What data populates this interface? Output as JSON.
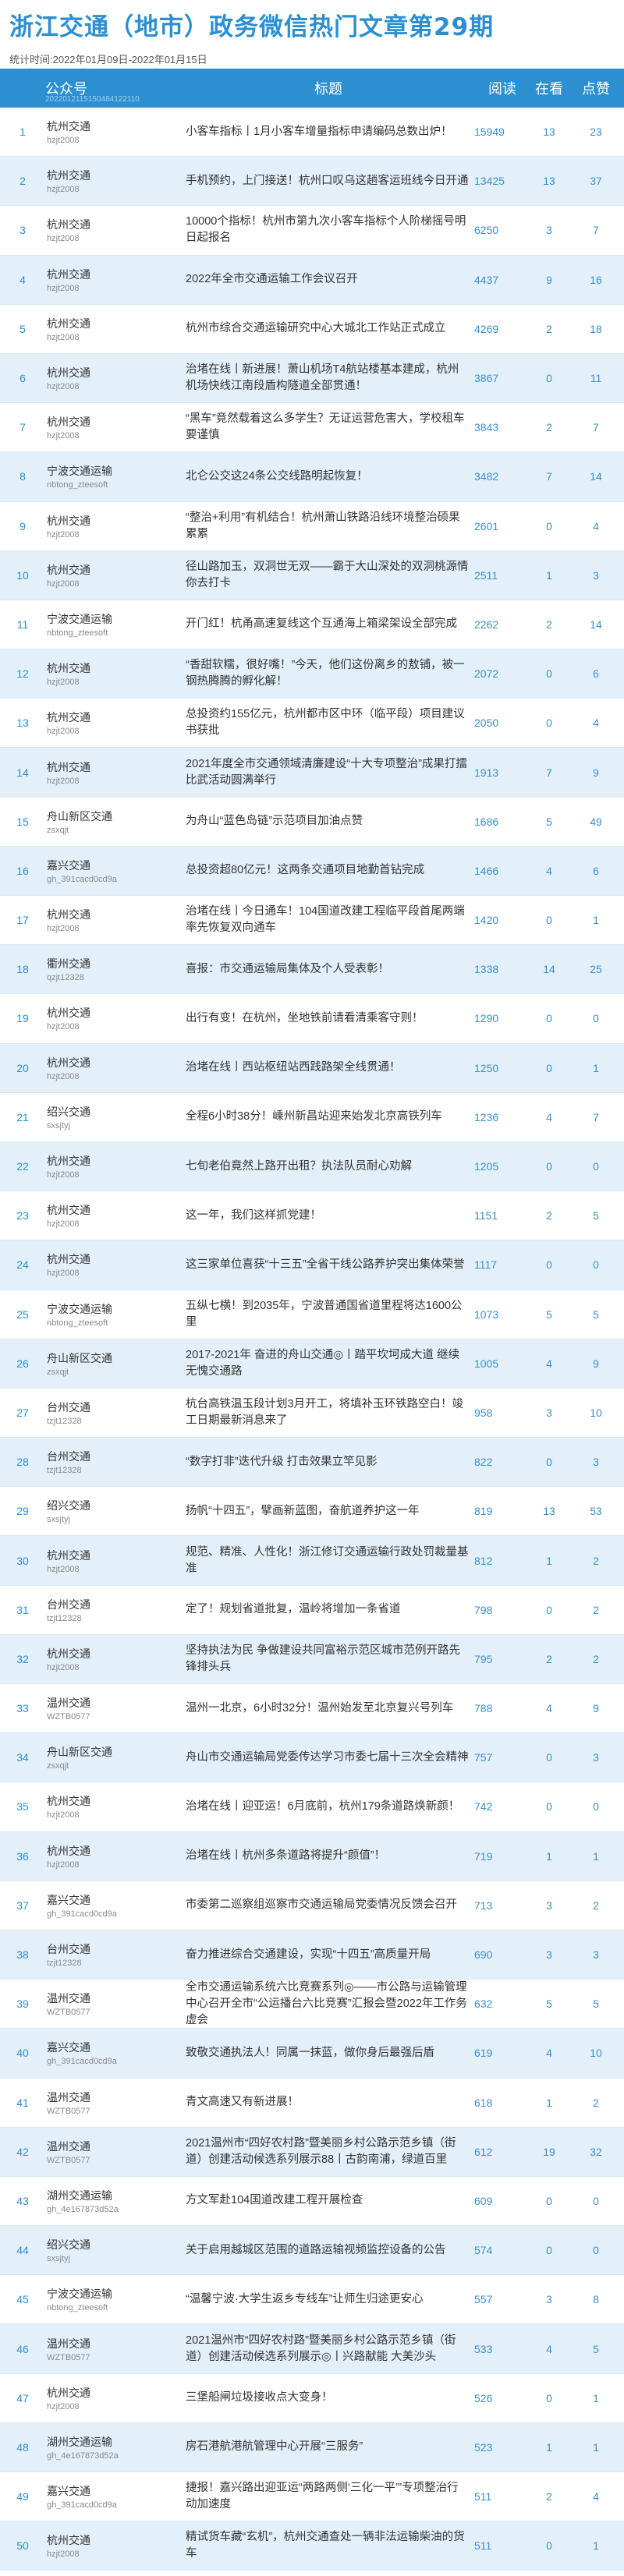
{
  "title": "浙江交通（地市）政务微信热门文章第29期",
  "stat_period": "统计时间:2022年01月09日-2022年01月15日",
  "header": {
    "col_name": "公众号",
    "col_title": "标题",
    "col_read": "阅读",
    "col_look": "在看",
    "col_like": "点赞",
    "sub": "2022012115150484122110"
  },
  "rows": [
    {
      "idx": "1",
      "name": "杭州交通",
      "id": "hzjt2008",
      "title": "小客车指标丨1月小客车增量指标申请编码总数出炉！",
      "read": "15949",
      "look": "13",
      "like": "23"
    },
    {
      "idx": "2",
      "name": "杭州交通",
      "id": "hzjt2008",
      "title": "手机预约，上门接送！杭州口叹乌这趟客运班线今日开通",
      "read": "13425",
      "look": "13",
      "like": "37"
    },
    {
      "idx": "3",
      "name": "杭州交通",
      "id": "hzjt2008",
      "title": "10000个指标！杭州市第九次小客车指标个人阶梯摇号明日起报名",
      "read": "6250",
      "look": "3",
      "like": "7"
    },
    {
      "idx": "4",
      "name": "杭州交通",
      "id": "hzjt2008",
      "title": "2022年全市交通运输工作会议召开",
      "read": "4437",
      "look": "9",
      "like": "16"
    },
    {
      "idx": "5",
      "name": "杭州交通",
      "id": "hzjt2008",
      "title": "杭州市综合交通运输研究中心大城北工作站正式成立",
      "read": "4269",
      "look": "2",
      "like": "18"
    },
    {
      "idx": "6",
      "name": "杭州交通",
      "id": "hzjt2008",
      "title": "治堵在线丨新进展！萧山机场T4航站楼基本建成，杭州机场快线江南段盾构隧道全部贯通！",
      "read": "3867",
      "look": "0",
      "like": "11"
    },
    {
      "idx": "7",
      "name": "杭州交通",
      "id": "hzjt2008",
      "title": "“黑车”竟然载着这么多学生？无证运营危害大，学校租车要谨慎",
      "read": "3843",
      "look": "2",
      "like": "7"
    },
    {
      "idx": "8",
      "name": "宁波交通运输",
      "id": "nbtong_zteesoft",
      "title": "北仑公交这24条公交线路明起恢复！",
      "read": "3482",
      "look": "7",
      "like": "14"
    },
    {
      "idx": "9",
      "name": "杭州交通",
      "id": "hzjt2008",
      "title": "“整治+利用”有机结合！杭州萧山铁路沿线环境整治硕果累累",
      "read": "2601",
      "look": "0",
      "like": "4"
    },
    {
      "idx": "10",
      "name": "杭州交通",
      "id": "hzjt2008",
      "title": "径山路加玉，双洞世无双——霸于大山深处的双洞桃源情你去打卡",
      "read": "2511",
      "look": "1",
      "like": "3"
    },
    {
      "idx": "11",
      "name": "宁波交通运输",
      "id": "nbtong_zteesoft",
      "title": "开门红！杭甬高速复线这个互通海上箱梁架设全部完成",
      "read": "2262",
      "look": "2",
      "like": "14"
    },
    {
      "idx": "12",
      "name": "杭州交通",
      "id": "hzjt2008",
      "title": "“香甜软糯，很好嘴！”今天，他们这份离乡的敖铺，被一钢热腾腾的孵化解！",
      "read": "2072",
      "look": "0",
      "like": "6"
    },
    {
      "idx": "13",
      "name": "杭州交通",
      "id": "hzjt2008",
      "title": "总投资约155亿元，杭州都市区中环（临平段）项目建议书获批",
      "read": "2050",
      "look": "0",
      "like": "4"
    },
    {
      "idx": "14",
      "name": "杭州交通",
      "id": "hzjt2008",
      "title": "2021年度全市交通领域清廉建设“十大专项整治”成果打擂比武活动圆满举行",
      "read": "1913",
      "look": "7",
      "like": "9"
    },
    {
      "idx": "15",
      "name": "舟山新区交通",
      "id": "zsxqjt",
      "title": "为舟山“蓝色岛链”示范项目加油点赞",
      "read": "1686",
      "look": "5",
      "like": "49"
    },
    {
      "idx": "16",
      "name": "嘉兴交通",
      "id": "gh_391cacd0cd9a",
      "title": "总投资超80亿元！这两条交通项目地勤首钻完成",
      "read": "1466",
      "look": "4",
      "like": "6"
    },
    {
      "idx": "17",
      "name": "杭州交通",
      "id": "hzjt2008",
      "title": "治堵在线丨今日通车！104国道改建工程临平段首尾两端率先恢复双向通车",
      "read": "1420",
      "look": "0",
      "like": "1"
    },
    {
      "idx": "18",
      "name": "衢州交通",
      "id": "qzjt12328",
      "title": "喜报：市交通运输局集体及个人受表彰！",
      "read": "1338",
      "look": "14",
      "like": "25"
    },
    {
      "idx": "19",
      "name": "杭州交通",
      "id": "hzjt2008",
      "title": "出行有变！在杭州，坐地铁前请看清乘客守则！",
      "read": "1290",
      "look": "0",
      "like": "0"
    },
    {
      "idx": "20",
      "name": "杭州交通",
      "id": "hzjt2008",
      "title": "治堵在线丨西站枢纽站西践路架全线贯通！",
      "read": "1250",
      "look": "0",
      "like": "1"
    },
    {
      "idx": "21",
      "name": "绍兴交通",
      "id": "sxsjtyj",
      "title": "全程6小时38分！嵊州新昌站迎来始发北京高铁列车",
      "read": "1236",
      "look": "4",
      "like": "7"
    },
    {
      "idx": "22",
      "name": "杭州交通",
      "id": "hzjt2008",
      "title": "七旬老伯竟然上路开出租？执法队员耐心劝解",
      "read": "1205",
      "look": "0",
      "like": "0"
    },
    {
      "idx": "23",
      "name": "杭州交通",
      "id": "hzjt2008",
      "title": "这一年，我们这样抓党建！",
      "read": "1151",
      "look": "2",
      "like": "5"
    },
    {
      "idx": "24",
      "name": "杭州交通",
      "id": "hzjt2008",
      "title": "这三家单位喜获“十三五”全省干线公路养护突出集体荣誉",
      "read": "1117",
      "look": "0",
      "like": "0"
    },
    {
      "idx": "25",
      "name": "宁波交通运输",
      "id": "nbtong_zteesoft",
      "title": "五纵七横！到2035年，宁波普通国省道里程将达1600公里",
      "read": "1073",
      "look": "5",
      "like": "5"
    },
    {
      "idx": "26",
      "name": "舟山新区交通",
      "id": "zsxqjt",
      "title": "2017-2021年 奋进的舟山交通◎丨踏平坎坷成大道 继续无愧交通路",
      "read": "1005",
      "look": "4",
      "like": "9"
    },
    {
      "idx": "27",
      "name": "台州交通",
      "id": "tzjt12328",
      "title": "杭台高铁温玉段计划3月开工，将填补玉环铁路空白！竣工日期最新消息来了",
      "read": "958",
      "look": "3",
      "like": "10"
    },
    {
      "idx": "28",
      "name": "台州交通",
      "id": "tzjt12328",
      "title": "“数字打非”迭代升级 打击效果立竿见影",
      "read": "822",
      "look": "0",
      "like": "3"
    },
    {
      "idx": "29",
      "name": "绍兴交通",
      "id": "sxsjtyj",
      "title": "扬帆“十四五”，擘画新蓝图，奋航道养护这一年",
      "read": "819",
      "look": "13",
      "like": "53"
    },
    {
      "idx": "30",
      "name": "杭州交通",
      "id": "hzjt2008",
      "title": "规范、精准、人性化！浙江修订交通运输行政处罚裁量基准",
      "read": "812",
      "look": "1",
      "like": "2"
    },
    {
      "idx": "31",
      "name": "台州交通",
      "id": "tzjt12328",
      "title": "定了！规划省道批复，温岭将增加一条省道",
      "read": "798",
      "look": "0",
      "like": "2"
    },
    {
      "idx": "32",
      "name": "杭州交通",
      "id": "hzjt2008",
      "title": "坚持执法为民 争做建设共同富裕示范区城市范例开路先锋排头兵",
      "read": "795",
      "look": "2",
      "like": "2"
    },
    {
      "idx": "33",
      "name": "温州交通",
      "id": "WZTB0577",
      "title": "温州一北京，6小时32分！温州始发至北京复兴号列车",
      "read": "788",
      "look": "4",
      "like": "9"
    },
    {
      "idx": "34",
      "name": "舟山新区交通",
      "id": "zsxqjt",
      "title": "舟山市交通运输局党委传达学习市委七届十三次全会精神",
      "read": "757",
      "look": "0",
      "like": "3"
    },
    {
      "idx": "35",
      "name": "杭州交通",
      "id": "hzjt2008",
      "title": "治堵在线丨迎亚运！6月底前，杭州179条道路焕新颜！",
      "read": "742",
      "look": "0",
      "like": "0"
    },
    {
      "idx": "36",
      "name": "杭州交通",
      "id": "hzjt2008",
      "title": "治堵在线丨杭州多条道路将提升“颜值”！",
      "read": "719",
      "look": "1",
      "like": "1"
    },
    {
      "idx": "37",
      "name": "嘉兴交通",
      "id": "gh_391cacd0cd9a",
      "title": "市委第二巡察组巡察市交通运输局党委情况反馈会召开",
      "read": "713",
      "look": "3",
      "like": "2"
    },
    {
      "idx": "38",
      "name": "台州交通",
      "id": "tzjt12328",
      "title": "奋力推进综合交通建设，实现“十四五”高质量开局",
      "read": "690",
      "look": "3",
      "like": "3"
    },
    {
      "idx": "39",
      "name": "温州交通",
      "id": "WZTB0577",
      "title": "全市交通运输系统六比竞赛系列◎——市公路与运输管理中心召开全市“公运播台六比竞赛”汇报会暨2022年工作务虚会",
      "read": "632",
      "look": "5",
      "like": "5"
    },
    {
      "idx": "40",
      "name": "嘉兴交通",
      "id": "gh_391cacd0cd9a",
      "title": "致敬交通执法人！同属一抹蓝，做你身后最强后盾",
      "read": "619",
      "look": "4",
      "like": "10"
    },
    {
      "idx": "41",
      "name": "温州交通",
      "id": "WZTB0577",
      "title": "青文高速又有新进展！",
      "read": "618",
      "look": "1",
      "like": "2"
    },
    {
      "idx": "42",
      "name": "温州交通",
      "id": "WZTB0577",
      "title": "2021温州市“四好农村路”暨美丽乡村公路示范乡镇（街道）创建活动候选系列展示88丨古韵南浦，绿道百里",
      "read": "612",
      "look": "19",
      "like": "32"
    },
    {
      "idx": "43",
      "name": "湖州交通运输",
      "id": "gh_4e167873d52a",
      "title": "方文军赴104国道改建工程开展检查",
      "read": "609",
      "look": "0",
      "like": "0"
    },
    {
      "idx": "44",
      "name": "绍兴交通",
      "id": "sxsjtyj",
      "title": "关于启用越城区范围的道路运输视频监控设备的公告",
      "read": "574",
      "look": "0",
      "like": "0"
    },
    {
      "idx": "45",
      "name": "宁波交通运输",
      "id": "nbtong_zteesoft",
      "title": "“温馨宁波·大学生返乡专线车”让师生归途更安心",
      "read": "557",
      "look": "3",
      "like": "8"
    },
    {
      "idx": "46",
      "name": "温州交通",
      "id": "WZTB0577",
      "title": "2021温州市“四好农村路”暨美丽乡村公路示范乡镇（街道）创建活动候选系列展示◎丨兴路献能 大美沙头",
      "read": "533",
      "look": "4",
      "like": "5"
    },
    {
      "idx": "47",
      "name": "杭州交通",
      "id": "hzjt2008",
      "title": "三堡船闸垃圾接收点大变身！",
      "read": "526",
      "look": "0",
      "like": "1"
    },
    {
      "idx": "48",
      "name": "湖州交通运输",
      "id": "gh_4e167873d52a",
      "title": "房石港航港航管理中心开展“三服务”",
      "read": "523",
      "look": "1",
      "like": "1"
    },
    {
      "idx": "49",
      "name": "嘉兴交通",
      "id": "gh_391cacd0cd9a",
      "title": "捷报！嘉兴路出迎亚运“两路两侧‘三化一平’”专项整治行动加速度",
      "read": "511",
      "look": "2",
      "like": "4"
    },
    {
      "idx": "50",
      "name": "杭州交通",
      "id": "hzjt2008",
      "title": "精试货车藏“玄机”，杭州交通查处一辆非法运输柴油的货车",
      "read": "511",
      "look": "0",
      "like": "1"
    }
  ]
}
